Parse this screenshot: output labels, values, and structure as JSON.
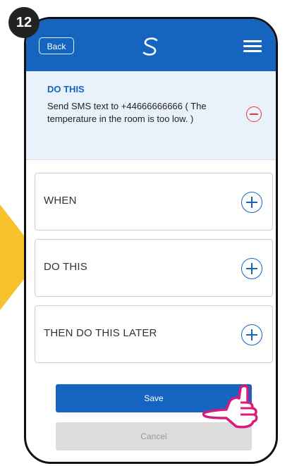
{
  "step_badge": "12",
  "header": {
    "back_label": "Back",
    "logo_icon": "logo-s-icon",
    "menu_icon": "hamburger-menu-icon"
  },
  "do_panel": {
    "title": "DO THIS",
    "text": "Send SMS text to +44666666666 ( The temperature in the room is too low. )",
    "remove_icon": "minus-circle-icon"
  },
  "sections": [
    {
      "label": "WHEN",
      "icon": "plus-circle-icon"
    },
    {
      "label": "DO THIS",
      "icon": "plus-circle-icon"
    },
    {
      "label": "THEN DO THIS LATER",
      "icon": "plus-circle-icon"
    }
  ],
  "buttons": {
    "save": "Save",
    "cancel": "Cancel"
  },
  "colors": {
    "primary": "#1565c0",
    "accent_arrow": "#f8c22c",
    "remove": "#e53935",
    "hand": "#d81b7a"
  }
}
